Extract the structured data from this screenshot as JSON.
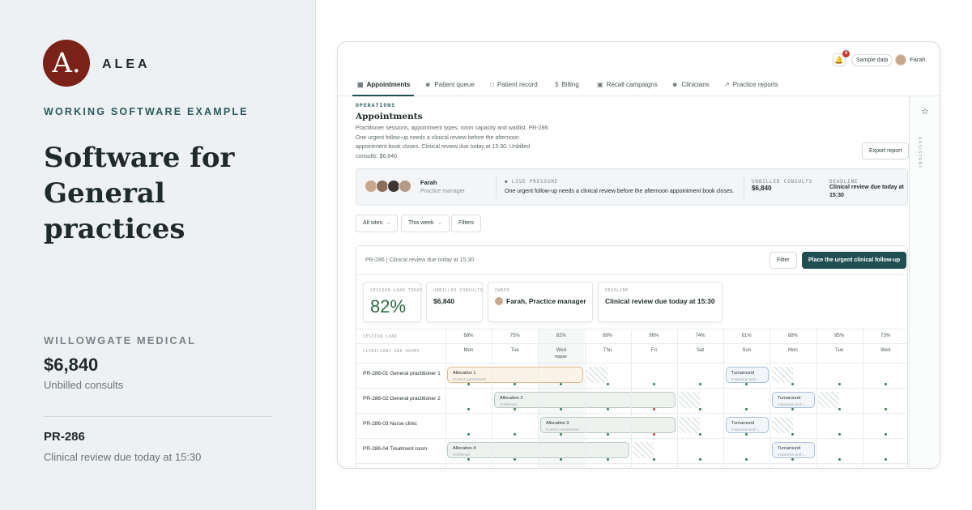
{
  "promo": {
    "logo_letter": "A.",
    "brand": "ALEA",
    "eyebrow": "WORKING SOFTWARE EXAMPLE",
    "headline": "Software for General practices",
    "org_label": "WILLOWGATE MEDICAL",
    "metric_value": "$6,840",
    "metric_caption": "Unbilled consults",
    "record_id": "PR-286",
    "record_desc": "Clinical review due today at 15:30"
  },
  "topbar": {
    "notification_count": "4",
    "sample_data_label": "Sample data",
    "user_name": "Farah"
  },
  "tabs": [
    {
      "label": "Appointments",
      "icon": "calendar-icon",
      "active": true
    },
    {
      "label": "Patient queue",
      "icon": "people-icon"
    },
    {
      "label": "Patient record",
      "icon": "document-icon"
    },
    {
      "label": "Billing",
      "icon": "dollar-icon"
    },
    {
      "label": "Recall campaigns",
      "icon": "inbox-icon"
    },
    {
      "label": "Clinicians",
      "icon": "people-icon"
    },
    {
      "label": "Practice reports",
      "icon": "chart-icon"
    }
  ],
  "side_rail": {
    "label": "ASSISTANT",
    "icon": "star-icon"
  },
  "page": {
    "eyebrow": "OPERATIONS",
    "title": "Appointments",
    "description": "Practitioner sessions, appointment types, room capacity and waitlist. PR-286: One urgent follow-up needs a clinical review before the afternoon appointment book closes. Clinical review due today at 15:30. Unbilled consults: $6,840.",
    "export_label": "Export report"
  },
  "pressure": {
    "owner_name": "Farah",
    "owner_role": "Practice manager",
    "live_label": "● LIVE PRESSURE",
    "live_text": "One urgent follow-up needs a clinical review before the afternoon appointment book closes.",
    "unbilled_label": "UNBILLED CONSULTS",
    "unbilled_value": "$6,840",
    "deadline_label": "DEADLINE",
    "deadline_value": "Clinical review due today at 15:30"
  },
  "filters": {
    "sites": "All sites",
    "period": "This week",
    "filters_label": "Filters"
  },
  "panel": {
    "title": "PR-286 | Clinical review due today at 15:30",
    "filter_label": "Filter",
    "primary_label": "Place the urgent clinical follow-up",
    "metrics": {
      "session_load_label": "SESSION LOAD TODAY",
      "session_load_value": "82%",
      "unbilled_label": "UNBILLED CONSULTS",
      "unbilled_value": "$6,840",
      "owner_label": "OWNER",
      "owner_value": "Farah, Practice manager",
      "deadline_label": "DEADLINE",
      "deadline_value": "Clinical review due today at 15:30"
    }
  },
  "schedule": {
    "session_load_label": "SESSION LOAD",
    "rooms_label": "CLINICIANS AND ROOMS",
    "today_tag": "TODAY",
    "columns": [
      {
        "pct": "68%",
        "day": "Mon"
      },
      {
        "pct": "75%",
        "day": "Tue"
      },
      {
        "pct": "82%",
        "day": "Wed"
      },
      {
        "pct": "89%",
        "day": "Thu"
      },
      {
        "pct": "96%",
        "day": "Fri"
      },
      {
        "pct": "74%",
        "day": "Sat"
      },
      {
        "pct": "81%",
        "day": "Sun"
      },
      {
        "pct": "88%",
        "day": "Mon"
      },
      {
        "pct": "95%",
        "day": "Tue"
      },
      {
        "pct": "73%",
        "day": "Wed"
      }
    ],
    "rows": [
      {
        "label": "PR-286-01 General practitioner 1",
        "alloc": "Allocation 1",
        "alloc_sub": "Current commitment",
        "turn": "Turnaround",
        "turn_sub": "Inspection and r..."
      },
      {
        "label": "PR-286-02 General practitioner 2",
        "alloc": "Allocation 2",
        "alloc_sub": "Confirmed",
        "turn": "Turnaround",
        "turn_sub": "Inspection and r..."
      },
      {
        "label": "PR-286-03 Nurse clinic",
        "alloc": "Allocation 3",
        "alloc_sub": "Current commitment",
        "turn": "Turnaround",
        "turn_sub": "Inspection and r..."
      },
      {
        "label": "PR-286-04 Treatment room",
        "alloc": "Allocation 4",
        "alloc_sub": "Confirmed",
        "turn": "Turnaround",
        "turn_sub": "Inspection and r..."
      }
    ]
  },
  "colors": {
    "brand_red": "#7a2218",
    "primary": "#1f4f52",
    "accent_green": "#2e6b45",
    "badge_red": "#c73a2f"
  }
}
